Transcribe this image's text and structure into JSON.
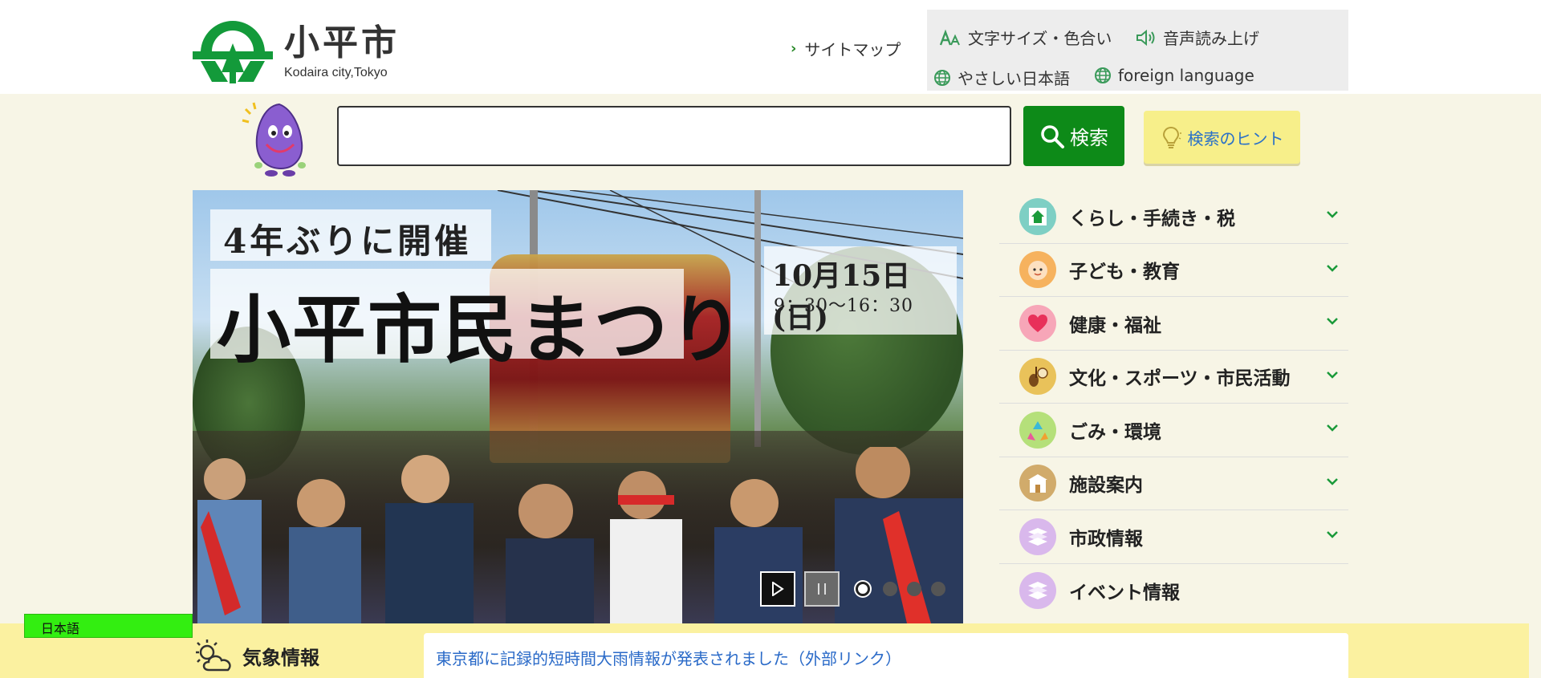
{
  "header": {
    "logo_title": "小平市",
    "logo_sub": "Kodaira city,Tokyo",
    "sitemap": "サイトマップ",
    "text_size_color": "文字サイズ・色合い",
    "voice_read": "音声読み上げ",
    "easy_japanese": "やさしい日本語",
    "foreign_language": "foreign language"
  },
  "search": {
    "placeholder": "",
    "button_label": "検索",
    "hint_label": "検索のヒント"
  },
  "hero": {
    "subtitle": "4年ぶりに開催",
    "title": "小平市民まつり",
    "date": "10月15日(日)",
    "time": "9：30〜16：30",
    "slides": 4,
    "active_slide": 1
  },
  "menu": {
    "items": [
      {
        "label": "くらし・手続き・税",
        "icon": "house-icon",
        "color": "#7ecfc4"
      },
      {
        "label": "子ども・教育",
        "icon": "child-face-icon",
        "color": "#f6b25e"
      },
      {
        "label": "健康・福祉",
        "icon": "heart-icon",
        "color": "#f7a6b8"
      },
      {
        "label": "文化・スポーツ・市民活動",
        "icon": "culture-icon",
        "color": "#e9c25a"
      },
      {
        "label": "ごみ・環境",
        "icon": "recycle-icon",
        "color": "#b5e07a"
      },
      {
        "label": "施設案内",
        "icon": "building-icon",
        "color": "#d1ab6b"
      },
      {
        "label": "市政情報",
        "icon": "layers-icon",
        "color": "#d9b8ec"
      },
      {
        "label": "イベント情報",
        "icon": "layers-icon",
        "color": "#d9b8ec"
      }
    ]
  },
  "language_tab": "日本語",
  "weather": {
    "title": "気象情報",
    "link": "東京都に記録的短時間大雨情報が発表されました（外部リンク）"
  },
  "colors": {
    "brand_green": "#0d8a18",
    "background": "#f7f5e6",
    "hint_yellow": "#f7ef8a",
    "link_blue": "#2a6ac8"
  }
}
